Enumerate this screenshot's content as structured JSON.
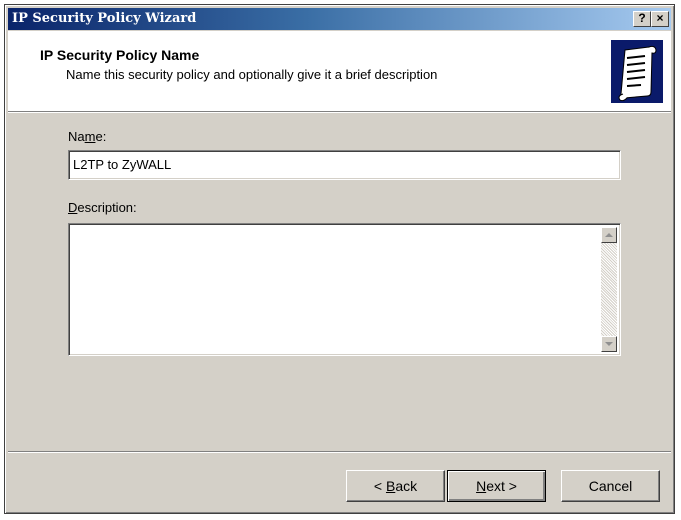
{
  "window": {
    "title": "IP Security Policy Wizard",
    "help_label": "?",
    "close_label": "×"
  },
  "header": {
    "title": "IP Security Policy Name",
    "subtitle": "Name this security policy and optionally give it a brief description",
    "icon": "scroll-document-icon"
  },
  "form": {
    "name_label_pre": "Na",
    "name_label_key": "m",
    "name_label_post": "e:",
    "name_value": "L2TP to ZyWALL",
    "description_label_key": "D",
    "description_label_post": "escription:",
    "description_value": ""
  },
  "buttons": {
    "back_pre": "< ",
    "back_key": "B",
    "back_post": "ack",
    "next_key": "N",
    "next_post": "ext >",
    "cancel": "Cancel"
  },
  "colors": {
    "dialog_bg": "#d4d0c8",
    "title_start": "#0a246a",
    "title_end": "#a6caf0",
    "icon_bg": "#0a1a6a"
  }
}
